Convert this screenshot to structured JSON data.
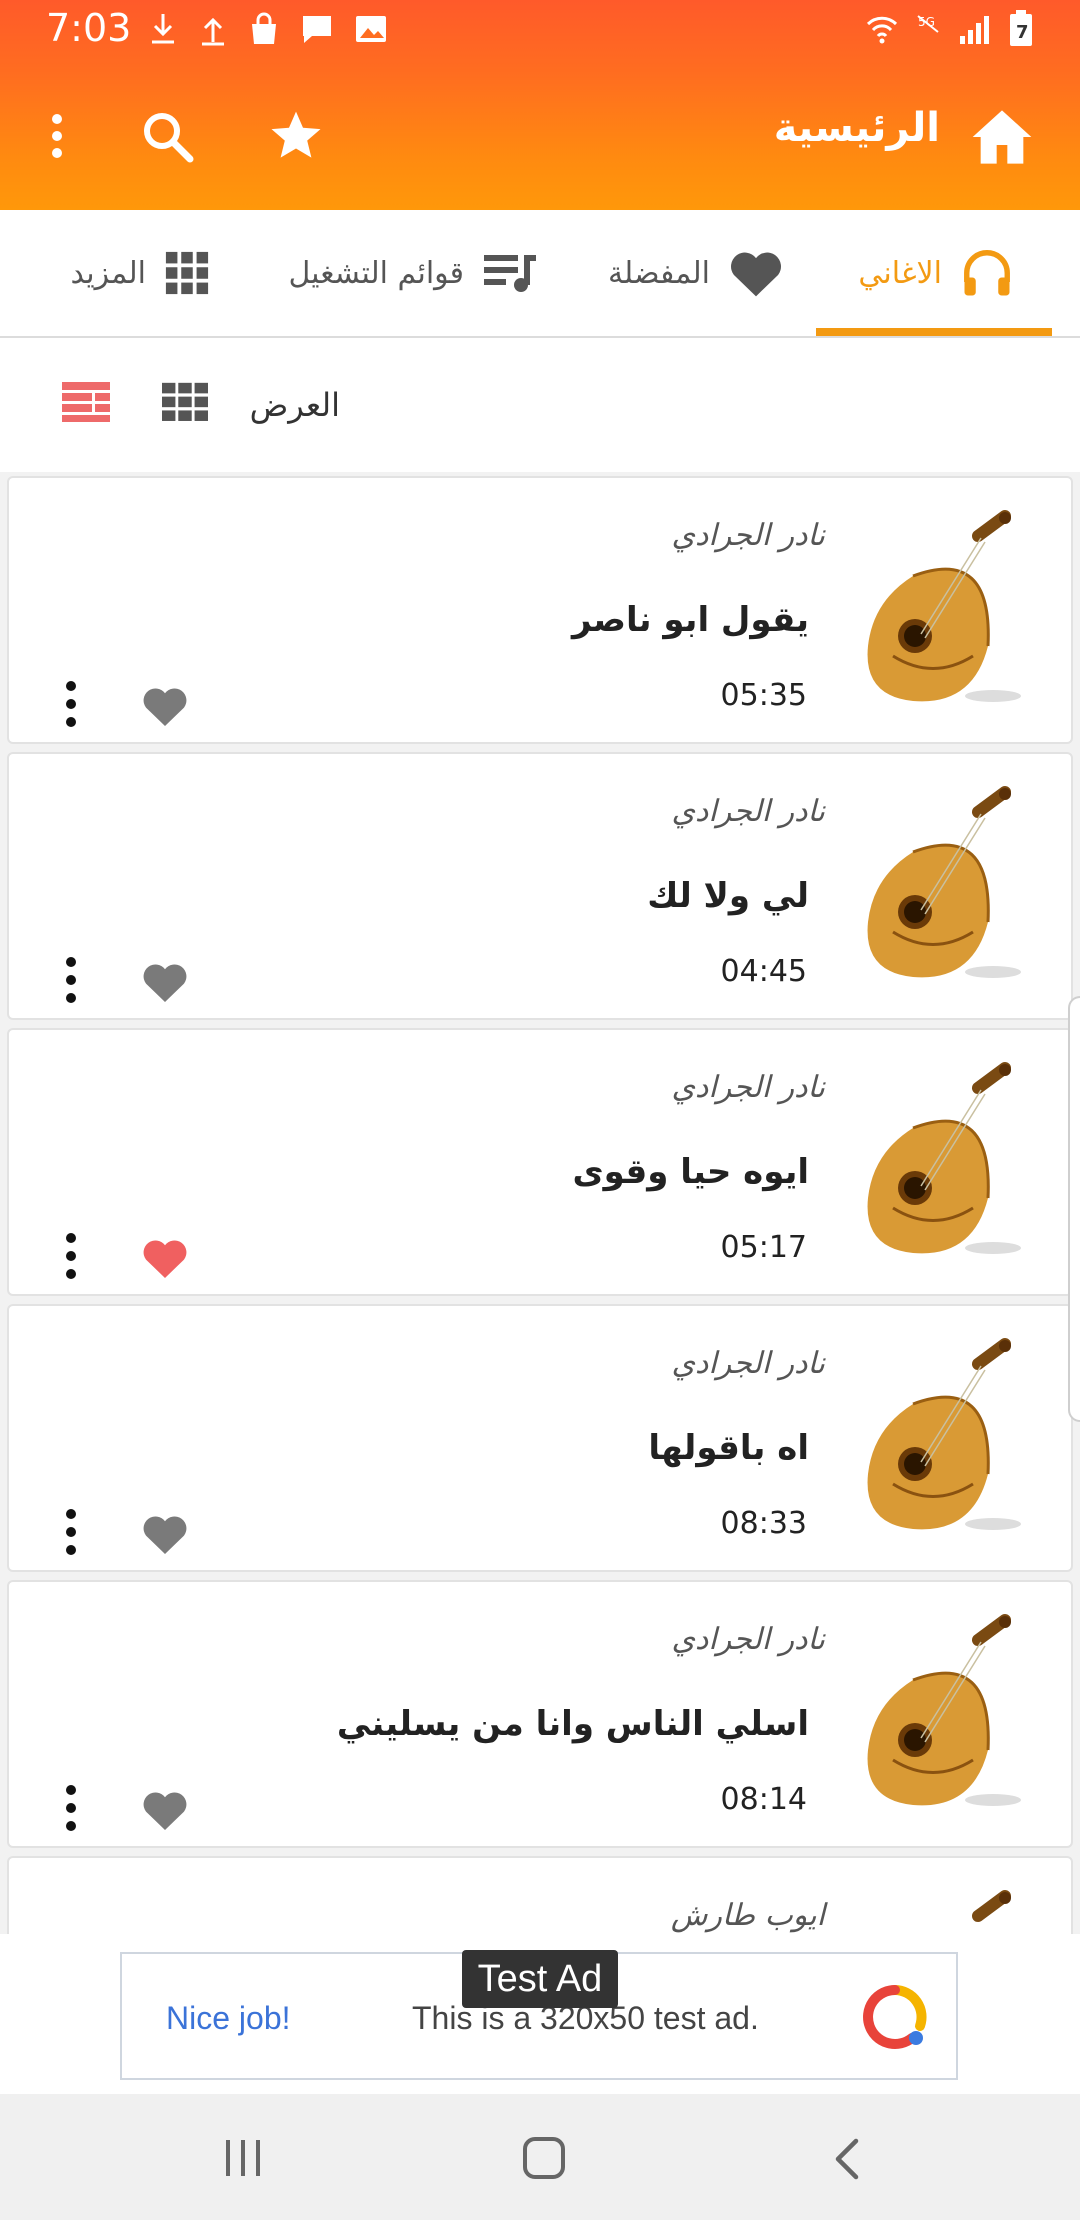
{
  "status_bar": {
    "time": "7:03"
  },
  "app_bar": {
    "title": "الرئيسية",
    "icons": [
      "home-icon",
      "star-icon",
      "search-icon",
      "more-vert-icon"
    ]
  },
  "tabs": [
    {
      "label": "الاغاني",
      "icon": "headphones-icon",
      "active": true
    },
    {
      "label": "المفضلة",
      "icon": "heart-icon",
      "active": false
    },
    {
      "label": "قوائم التشغيل",
      "icon": "playlist-icon",
      "active": false
    },
    {
      "label": "المزيد",
      "icon": "grid-icon",
      "active": false
    }
  ],
  "view": {
    "label": "العرض",
    "options": [
      "grid-view-icon",
      "list-view-icon"
    ]
  },
  "songs": [
    {
      "artist": "نادر الجرادي",
      "title": "يقول ابو ناصر",
      "duration": "05:35",
      "favorite": false
    },
    {
      "artist": "نادر الجرادي",
      "title": "لي ولا لك",
      "duration": "04:45",
      "favorite": false
    },
    {
      "artist": "نادر الجرادي",
      "title": "ايوه حيا وقوى",
      "duration": "05:17",
      "favorite": true
    },
    {
      "artist": "نادر الجرادي",
      "title": "اه باقولها",
      "duration": "08:33",
      "favorite": false
    },
    {
      "artist": "نادر الجرادي",
      "title": "اسلي الناس وانا من يسليني",
      "duration": "08:14",
      "favorite": false
    },
    {
      "artist": "ايوب طارش",
      "title": "",
      "duration": "",
      "favorite": false
    }
  ],
  "ad": {
    "badge": "Test Ad",
    "cta": "Nice job!",
    "text": "This is a 320x50 test ad."
  },
  "colors": {
    "accent": "#f39a12",
    "header_top": "#ff5a2a",
    "header_bottom": "#ff980a",
    "favorite": "#f06060",
    "heart_gray": "#7a7a7a"
  }
}
